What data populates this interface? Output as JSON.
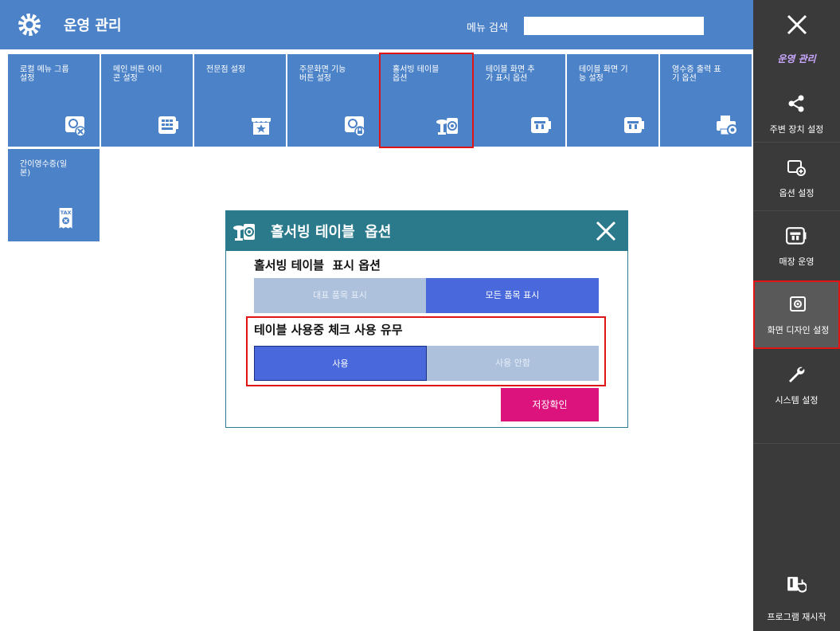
{
  "header": {
    "title": "운영 관리",
    "search_label": "메뉴 검색",
    "search_value": ""
  },
  "sidebar": {
    "section_title": "운영 관리",
    "items": [
      {
        "label": "주변 장치 설정",
        "icon": "share-icon"
      },
      {
        "label": "옵션 설정",
        "icon": "option-add-icon"
      },
      {
        "label": "매장 운영",
        "icon": "store-monitor-icon"
      },
      {
        "label": "화면 디자인 설정",
        "icon": "screen-design-icon",
        "active": true
      },
      {
        "label": "시스템 설정",
        "icon": "wrench-icon"
      }
    ],
    "restart_label": "프로그램 재시작"
  },
  "tiles": [
    {
      "label": "로컬 메뉴 그룹\n설정",
      "icon": "local-menu-icon"
    },
    {
      "label": "메인 버튼 아이\n콘 설정",
      "icon": "keypad-icon"
    },
    {
      "label": "전문점 설정",
      "icon": "store-star-icon"
    },
    {
      "label": "주문화면 기능\n버튼 설정",
      "icon": "order-lock-icon"
    },
    {
      "label": "홀서빙 테이블\n옵션",
      "icon": "hall-serving-icon",
      "selected": true
    },
    {
      "label": "테이블 화면 추\n가 표시 옵션",
      "icon": "table-display-icon"
    },
    {
      "label": "테이블 화면 기\n능 설정",
      "icon": "table-function-icon"
    },
    {
      "label": "영수증 출력 표\n기 옵션",
      "icon": "printer-gear-icon"
    },
    {
      "label": "간이영수증(일\n본)",
      "icon": "tax-receipt-icon"
    }
  ],
  "tax_text": "TAX",
  "dialog": {
    "title": "홀서빙 테이블  옵션",
    "section1_title": "홀서빙 테이블  표시 옵션",
    "section1_options": [
      "대표 품목 표시",
      "모든 품목 표시"
    ],
    "section1_selected": "모든 품목 표시",
    "section2_title": "테이블 사용중 체크 사용 유무",
    "section2_options": [
      "사용",
      "사용 안함"
    ],
    "section2_selected": "사용",
    "save_label": "저장확인"
  },
  "colors": {
    "header_bg": "#4c82c8",
    "sidebar_bg": "#3a3a3a",
    "dialog_header": "#2a7a8c",
    "selected_option": "#4868dc",
    "unselected_option": "#adc1dc",
    "save_button": "#dc137c",
    "highlight": "#e01414"
  }
}
